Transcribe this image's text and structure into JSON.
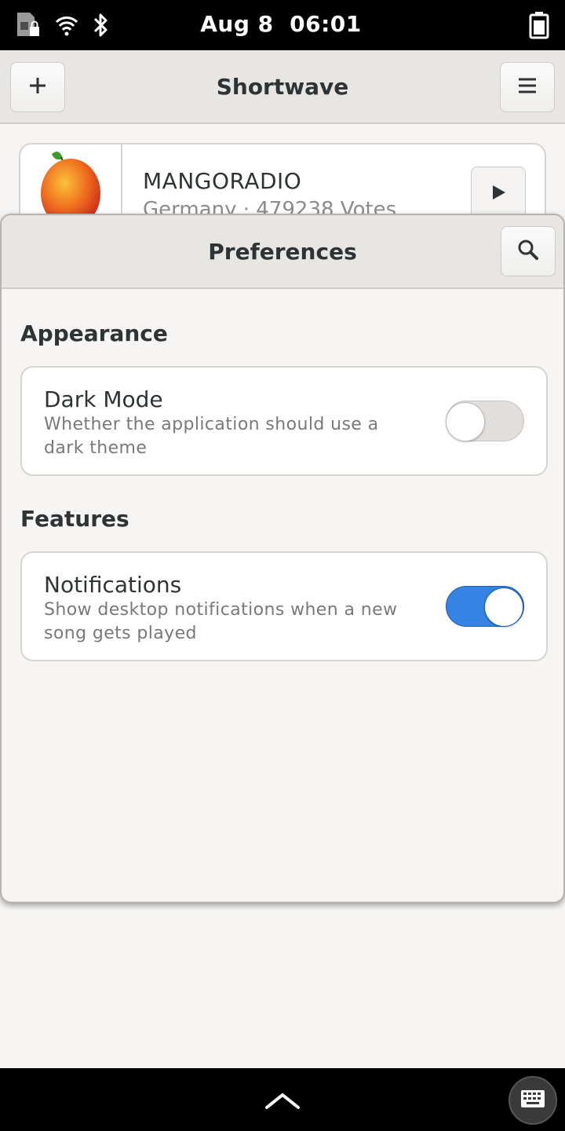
{
  "status_bar": {
    "date": "Aug 8",
    "time": "06:01",
    "icons": [
      "sim-locked-icon",
      "wifi-icon",
      "bluetooth-icon",
      "battery-icon"
    ]
  },
  "header": {
    "title": "Shortwave",
    "add_icon": "plus-icon",
    "menu_icon": "hamburger-menu-icon"
  },
  "station": {
    "name": "MANGORADIO",
    "meta": "Germany · 479238 Votes",
    "play_icon": "play-icon"
  },
  "preferences": {
    "title": "Preferences",
    "search_icon": "search-icon",
    "sections": [
      {
        "title": "Appearance",
        "rows": [
          {
            "title": "Dark Mode",
            "subtitle": "Whether the application should use a dark theme",
            "enabled": false
          }
        ]
      },
      {
        "title": "Features",
        "rows": [
          {
            "title": "Notifications",
            "subtitle": "Show desktop notifications when a new song gets played",
            "enabled": true
          }
        ]
      }
    ]
  },
  "bottom_bar": {
    "icons": [
      "chevron-up-icon",
      "keyboard-icon"
    ]
  },
  "colors": {
    "accent": "#3584e4",
    "background": "#f6f5f4",
    "headerbar": "#e8e6e3"
  }
}
